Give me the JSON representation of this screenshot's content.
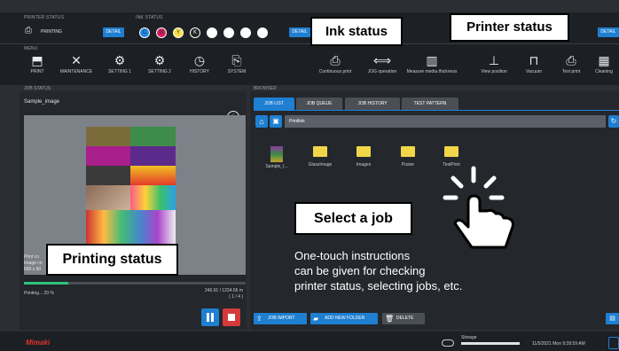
{
  "status_strip": {
    "printer_status_label": "PRINTER STATUS",
    "printer_state": "PRINTING",
    "detail_label": "DETAIL",
    "ink_status_label": "INK STATUS",
    "ink_colors": [
      "#1e88e5",
      "#d81b60",
      "#f9e04b",
      "#222222",
      "#ffffff",
      "#ffffff",
      "#ffffff",
      "#ffffff"
    ],
    "ink_letters": [
      "C",
      "M",
      "Y",
      "K",
      "",
      "",
      "",
      ""
    ]
  },
  "menu_label": "MENU",
  "menu": {
    "left_items": [
      {
        "label": "PRINT",
        "icon": "print-icon"
      },
      {
        "label": "MAINTENANCE",
        "icon": "wrench-icon"
      },
      {
        "label": "SETTING 1",
        "icon": "gears-icon"
      },
      {
        "label": "SETTING 2",
        "icon": "gears-icon"
      },
      {
        "label": "HISTORY",
        "icon": "history-icon"
      },
      {
        "label": "SYSTEM",
        "icon": "system-icon"
      }
    ],
    "right_items": [
      {
        "label": "Continuous print",
        "icon": "continuous-print-icon"
      },
      {
        "label": "JOG operation",
        "icon": "jog-icon"
      },
      {
        "label": "Measure media thickness",
        "icon": "measure-icon"
      },
      {
        "label": "View position",
        "icon": "view-position-icon"
      },
      {
        "label": "Vacuum",
        "icon": "vacuum-icon"
      },
      {
        "label": "Test print",
        "icon": "test-print-icon"
      },
      {
        "label": "Cleaning",
        "icon": "cleaning-icon"
      }
    ]
  },
  "job_status": {
    "header": "JOB STATUS",
    "job_name": "Sample_image",
    "progress_percent": 20,
    "progress_text": "Printing...  20 %",
    "length_text": "246.91 / 1234.56 m",
    "count_text": "( 1 / 4 )",
    "obscured_text_1": "Print co",
    "obscured_text_2": "Image co",
    "obscured_text_3": "600 x 90"
  },
  "browser": {
    "header": "BROWSER",
    "tabs": [
      "JOB LIST",
      "JOB QUEUE",
      "JOB HISTORY",
      "TEST PATTERN"
    ],
    "path": "Printlink",
    "items": [
      "Sample_I...",
      "GlassImage",
      "Images",
      "Poster",
      "TestPrint"
    ],
    "footer_buttons": [
      "JOB IMPORT",
      "ADD NEW FOLDER",
      "DELETE"
    ]
  },
  "footer": {
    "brand": "Mimaki",
    "storage_label": "Storage",
    "datetime": "11/5/2021 Mon 9:39:59 AM"
  },
  "callouts": {
    "ink_status": "Ink status",
    "printer_status": "Printer status",
    "select_job": "Select a job",
    "printing_status": "Printing status",
    "description": "One-touch instructions\ncan be given for checking\nprinter status, selecting jobs, etc."
  }
}
